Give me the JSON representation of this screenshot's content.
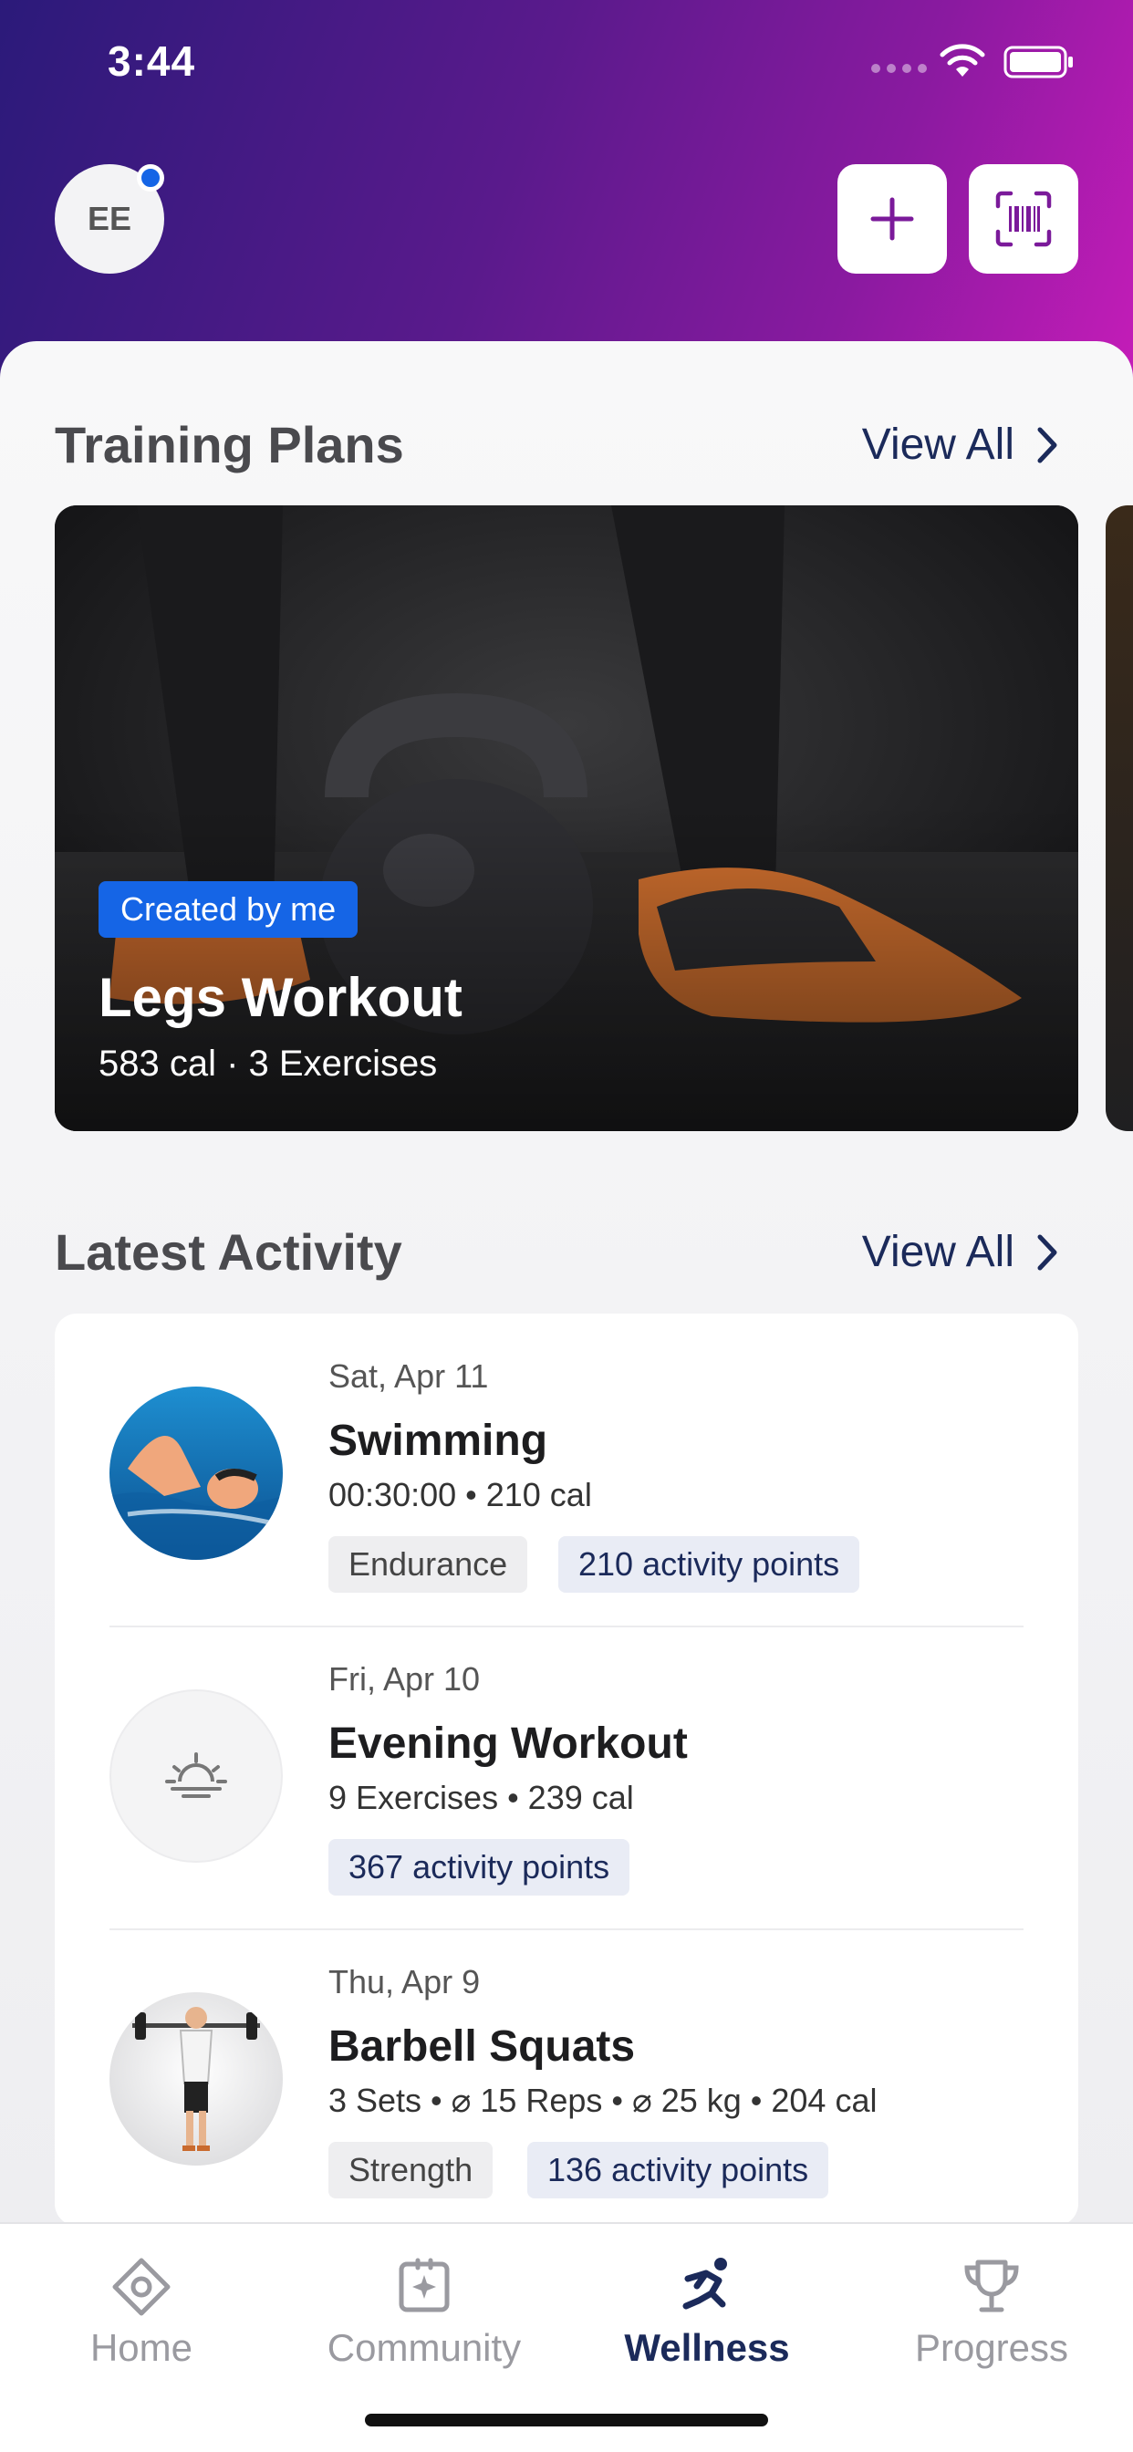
{
  "status_bar": {
    "time": "3:44"
  },
  "header": {
    "avatar_initials": "EE",
    "add_icon": "plus-icon",
    "scan_icon": "barcode-scan-icon"
  },
  "training_plans": {
    "title": "Training Plans",
    "view_all": "View All",
    "card": {
      "badge": "Created by me",
      "name": "Legs Workout",
      "meta": "583 cal · 3 Exercises"
    }
  },
  "latest_activity": {
    "title": "Latest Activity",
    "view_all": "View All",
    "items": [
      {
        "date": "Sat, Apr 11",
        "name": "Swimming",
        "stats": "00:30:00 • 210 cal",
        "tag": "Endurance",
        "points": "210 activity points",
        "icon": "swimmer-photo"
      },
      {
        "date": "Fri, Apr 10",
        "name": "Evening Workout",
        "stats": "9 Exercises • 239 cal",
        "points": "367 activity points",
        "icon": "sunset-icon"
      },
      {
        "date": "Thu, Apr 9",
        "name": "Barbell Squats",
        "stats": "3 Sets • ⌀ 15 Reps • ⌀ 25 kg • 204 cal",
        "tag": "Strength",
        "points": "136 activity points",
        "icon": "barbell-figure-photo"
      }
    ]
  },
  "tabbar": {
    "tabs": [
      {
        "label": "Home",
        "icon": "home-icon"
      },
      {
        "label": "Community",
        "icon": "community-icon"
      },
      {
        "label": "Wellness",
        "icon": "running-icon",
        "active": true
      },
      {
        "label": "Progress",
        "icon": "trophy-icon"
      }
    ]
  },
  "colors": {
    "accent_blue": "#1565e6",
    "navy": "#1b2a5a",
    "gradient_start": "#2b1a7a",
    "gradient_end": "#c41cb8"
  }
}
